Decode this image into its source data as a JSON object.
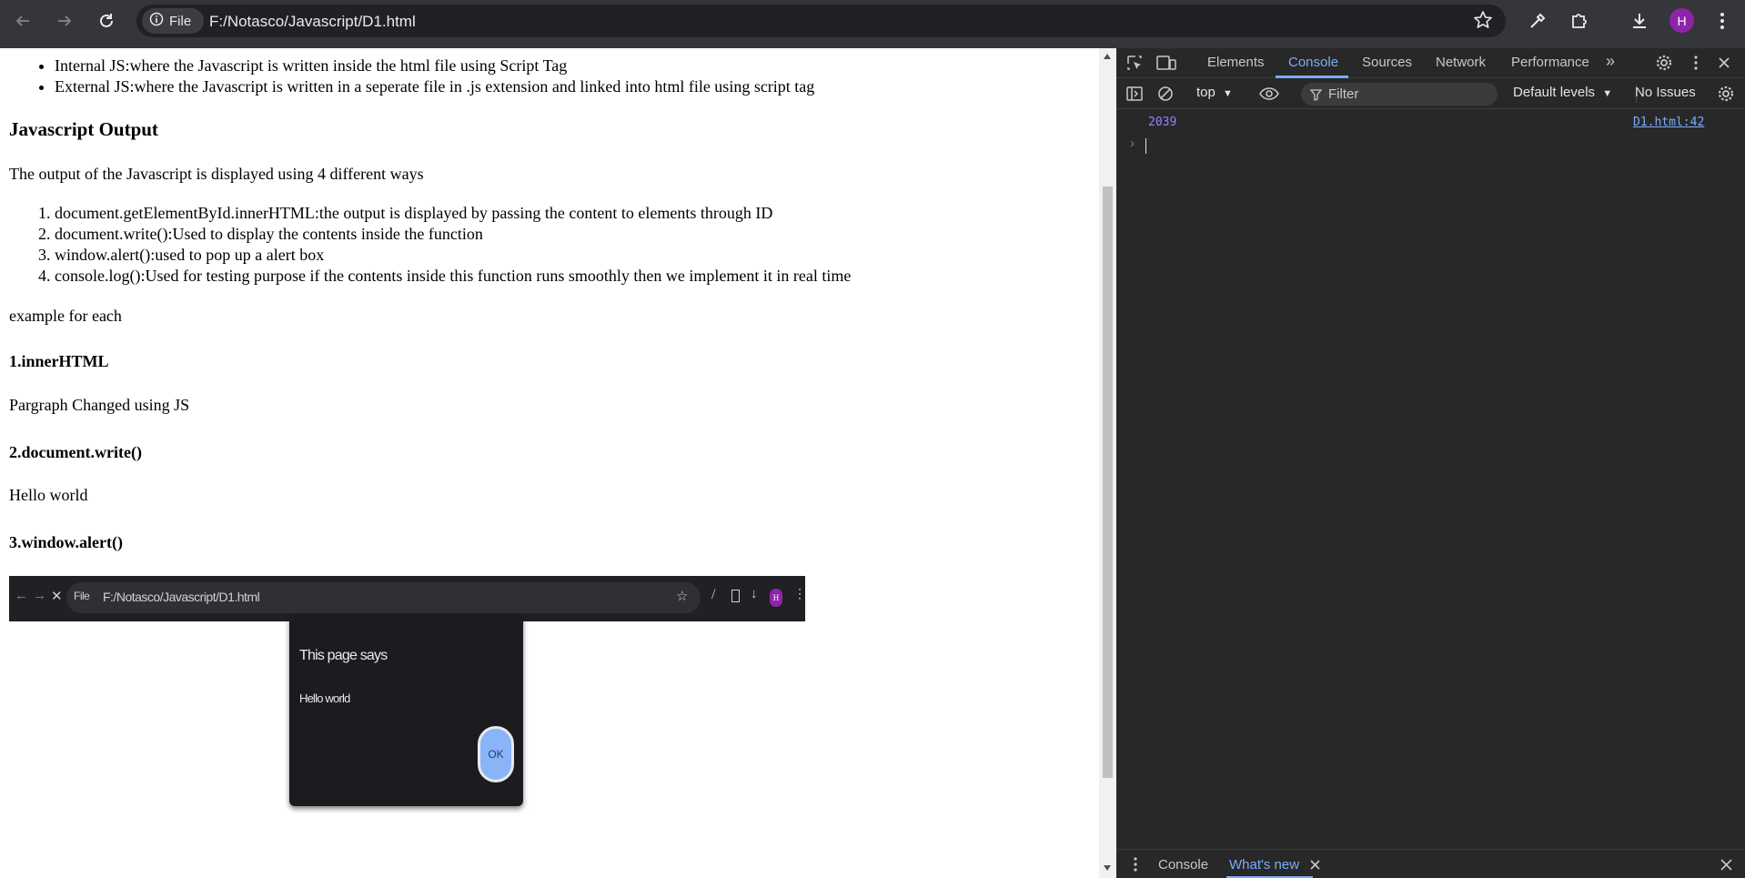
{
  "browser": {
    "site_chip_label": "File",
    "url": "F:/Notasco/Javascript/D1.html",
    "profile_initial": "H"
  },
  "page": {
    "list_js_types": [
      "Internal JS:where the Javascript is written inside the html file using Script Tag",
      "External JS:where the Javascript is written in a seperate file in .js extension and linked into html file using script tag"
    ],
    "heading_output": "Javascript Output",
    "output_intro": "The output of the Javascript is displayed using 4 different ways",
    "output_ways": [
      "document.getElementById.innerHTML:the output is displayed by passing the content to elements through ID",
      "document.write():Used to display the contents inside the function",
      "window.alert():used to pop up a alert box",
      "console.log():Used for testing purpose if the contents inside this function runs smoothly then we implement it in real time"
    ],
    "example_intro": "example for each",
    "ex1_title": "1.innerHTML",
    "ex1_result": "Pargraph Changed using JS",
    "ex2_title": "2.document.write()",
    "ex2_result": "Hello world",
    "ex3_title": "3.window.alert()",
    "screenshot": {
      "url": "F:/Notasco/Javascript/D1.html",
      "site_chip": "File",
      "dialog_title": "This page says",
      "dialog_message": "Hello world",
      "ok_label": "OK",
      "profile_initial": "H"
    }
  },
  "devtools": {
    "tabs": [
      "Elements",
      "Console",
      "Sources",
      "Network",
      "Performance"
    ],
    "active_tab": "Console",
    "context_select": "top",
    "filter_placeholder": "Filter",
    "levels_select": "Default levels",
    "issues": "No Issues",
    "console_log": {
      "value": "2039",
      "source": "D1.html:42"
    },
    "drawer_tabs": [
      "Console",
      "What's new"
    ],
    "active_drawer_tab": "What's new"
  },
  "colors": {
    "toolbar_bg": "#35363a",
    "omnibox_bg": "#202124",
    "devtools_bg": "#282828",
    "devtools_accent": "#7cacf8",
    "log_number": "#9980ff",
    "avatar": "#8e24aa"
  }
}
